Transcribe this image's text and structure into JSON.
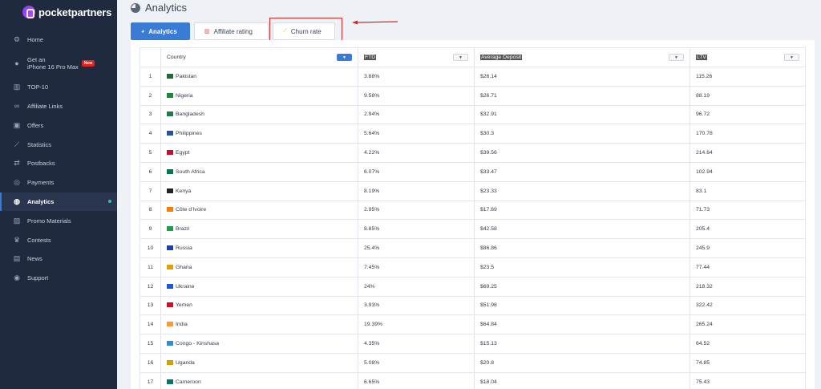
{
  "brand": {
    "name": "pocketpartners"
  },
  "sidebar": {
    "items": [
      {
        "label": "Home",
        "icon": "gear-icon"
      },
      {
        "label_line1": "Get an",
        "label_line2": "iPhone 16 Pro Max",
        "badge": "New",
        "icon": "apple-icon"
      },
      {
        "label": "TOP-10",
        "icon": "bar-chart-icon"
      },
      {
        "label": "Affiliate Links",
        "icon": "link-icon"
      },
      {
        "label": "Offers",
        "icon": "briefcase-icon"
      },
      {
        "label": "Statistics",
        "icon": "line-chart-icon"
      },
      {
        "label": "Postbacks",
        "icon": "postback-icon"
      },
      {
        "label": "Payments",
        "icon": "payment-icon"
      },
      {
        "label": "Analytics",
        "icon": "globe-icon",
        "active": true
      },
      {
        "label": "Promo Materials",
        "icon": "image-icon"
      },
      {
        "label": "Contests",
        "icon": "trophy-icon"
      },
      {
        "label": "News",
        "icon": "news-icon"
      },
      {
        "label": "Support",
        "icon": "support-icon"
      }
    ]
  },
  "header": {
    "title": "Analytics"
  },
  "tabs": [
    {
      "label": "Analytics",
      "active": true
    },
    {
      "label": "Affiliate rating"
    },
    {
      "label": "Churn rate"
    }
  ],
  "table": {
    "columns": [
      "Country",
      "FTD",
      "Average Deposit",
      "LTV"
    ],
    "rows": [
      {
        "n": "1",
        "country": "Pakistan",
        "ftd": "3.88%",
        "dep": "$26.14",
        "ltv": "115.26",
        "flag": "#1e6b35"
      },
      {
        "n": "2",
        "country": "Nigeria",
        "ftd": "9.58%",
        "dep": "$26.71",
        "ltv": "88.19",
        "flag": "#188a3e"
      },
      {
        "n": "3",
        "country": "Bangladesh",
        "ftd": "2.94%",
        "dep": "$32.91",
        "ltv": "96.72",
        "flag": "#1e7a4a"
      },
      {
        "n": "4",
        "country": "Philippines",
        "ftd": "5.64%",
        "dep": "$30.3",
        "ltv": "170.78",
        "flag": "#2a4fa8"
      },
      {
        "n": "5",
        "country": "Egypt",
        "ftd": "4.22%",
        "dep": "$39.56",
        "ltv": "214.64",
        "flag": "#c8102e"
      },
      {
        "n": "6",
        "country": "South Africa",
        "ftd": "6.07%",
        "dep": "$33.47",
        "ltv": "102.94",
        "flag": "#007a4d"
      },
      {
        "n": "7",
        "country": "Kenya",
        "ftd": "8.19%",
        "dep": "$23.33",
        "ltv": "83.1",
        "flag": "#222222"
      },
      {
        "n": "8",
        "country": "Côte d’Ivoire",
        "ftd": "2.95%",
        "dep": "$17.69",
        "ltv": "71.73",
        "flag": "#f77f00"
      },
      {
        "n": "9",
        "country": "Brazil",
        "ftd": "8.85%",
        "dep": "$42.58",
        "ltv": "205.4",
        "flag": "#229e45"
      },
      {
        "n": "10",
        "country": "Russia",
        "ftd": "25.4%",
        "dep": "$86.86",
        "ltv": "245.9",
        "flag": "#1c3fa8"
      },
      {
        "n": "11",
        "country": "Ghana",
        "ftd": "7.45%",
        "dep": "$23.5",
        "ltv": "77.44",
        "flag": "#e0a100"
      },
      {
        "n": "12",
        "country": "Ukraine",
        "ftd": "24%",
        "dep": "$69.25",
        "ltv": "218.32",
        "flag": "#1d5bd6"
      },
      {
        "n": "13",
        "country": "Yemen",
        "ftd": "3.93%",
        "dep": "$51.98",
        "ltv": "322.42",
        "flag": "#ce1126"
      },
      {
        "n": "14",
        "country": "India",
        "ftd": "19.39%",
        "dep": "$64.84",
        "ltv": "265.24",
        "flag": "#ff9933"
      },
      {
        "n": "15",
        "country": "Congo - Kinshasa",
        "ftd": "4.35%",
        "dep": "$15.13",
        "ltv": "64.52",
        "flag": "#2a8fd6"
      },
      {
        "n": "16",
        "country": "Uganda",
        "ftd": "5.08%",
        "dep": "$20.8",
        "ltv": "74.85",
        "flag": "#d4a000"
      },
      {
        "n": "17",
        "country": "Cameroon",
        "ftd": "6.65%",
        "dep": "$18.04",
        "ltv": "75.43",
        "flag": "#007a5e"
      }
    ]
  },
  "colors": {
    "accent": "#3a7bd5",
    "sidebar_bg": "#1f2a3e",
    "highlight": "#e02424"
  }
}
